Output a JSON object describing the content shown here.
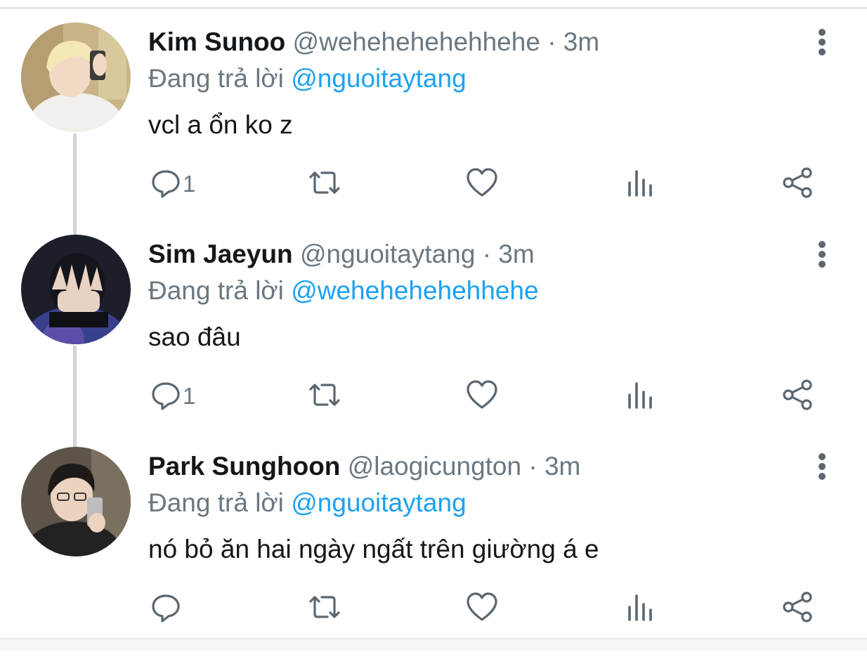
{
  "icon_color": "#5b6670",
  "mention_color": "#1da1f2",
  "tweets": [
    {
      "name": "Kim Sunoo",
      "handle": "@wehehehehehhehe",
      "time": "· 3m",
      "reply_prefix": "Đang trả lời ",
      "reply_to": "@nguoitaytang",
      "text": "vcl a ổn ko z",
      "reply_count": "1",
      "avatar": "avatar-kim-sunoo"
    },
    {
      "name": "Sim Jaeyun",
      "handle": "@nguoitaytang",
      "time": "· 3m",
      "reply_prefix": "Đang trả lời ",
      "reply_to": "@wehehehehehhehe",
      "text": "sao đâu",
      "reply_count": "1",
      "avatar": "avatar-sim-jaeyun"
    },
    {
      "name": "Park Sunghoon",
      "handle": "@laogicungton",
      "time": "· 3m",
      "reply_prefix": "Đang trả lời ",
      "reply_to": "@nguoitaytang",
      "text": "nó bỏ ăn hai ngày ngất trên giường á e",
      "reply_count": "",
      "avatar": "avatar-park-sunghoon"
    }
  ],
  "action_icons": [
    "reply-icon",
    "retweet-icon",
    "like-icon",
    "analytics-icon",
    "share-icon"
  ]
}
